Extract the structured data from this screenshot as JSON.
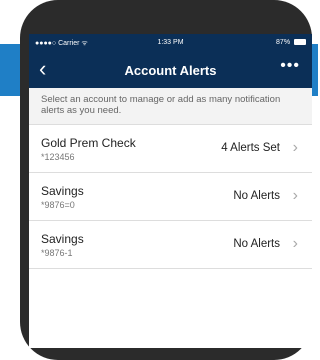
{
  "status_bar": {
    "carrier": "●●●●○ Carrier ᯤ",
    "time": "1:33 PM",
    "battery": "87%"
  },
  "nav": {
    "title": "Account Alerts",
    "back_icon": "‹",
    "more_icon": "•••"
  },
  "intro": "Select an account to manage or add as many notification alerts as you need.",
  "accounts": [
    {
      "name": "Gold Prem Check",
      "number": "*123456",
      "status": "4 Alerts Set"
    },
    {
      "name": "Savings",
      "number": "*9876=0",
      "status": "No Alerts"
    },
    {
      "name": "Savings",
      "number": "*9876-1",
      "status": "No Alerts"
    }
  ],
  "colors": {
    "nav": "#0b2f57",
    "band": "#1f7fc6",
    "phone": "#2b2b2b"
  }
}
